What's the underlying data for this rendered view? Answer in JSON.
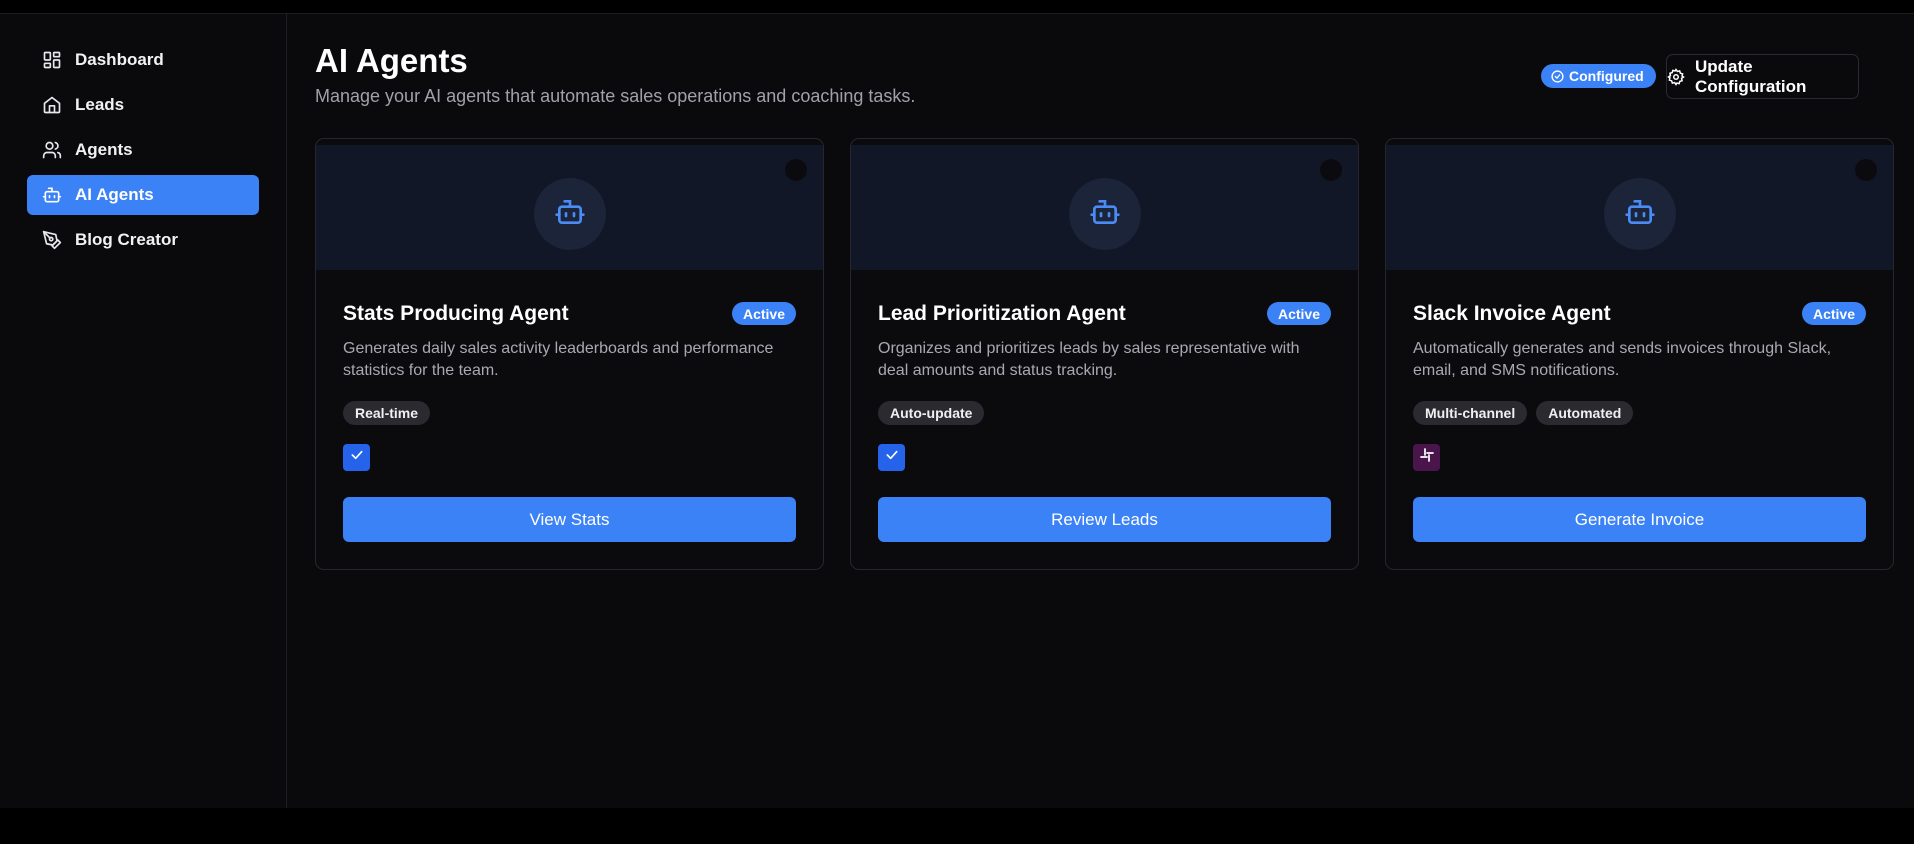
{
  "sidebar": {
    "items": [
      {
        "label": "Dashboard",
        "icon": "dashboard-icon",
        "active": false
      },
      {
        "label": "Leads",
        "icon": "home-icon",
        "active": false
      },
      {
        "label": "Agents",
        "icon": "users-icon",
        "active": false
      },
      {
        "label": "AI Agents",
        "icon": "bot-icon",
        "active": true
      },
      {
        "label": "Blog Creator",
        "icon": "pen-icon",
        "active": false
      }
    ]
  },
  "header": {
    "title": "AI Agents",
    "subtitle": "Manage your AI agents that automate sales operations and coaching tasks.",
    "configured_label": "Configured",
    "update_label": "Update Configuration"
  },
  "cards": [
    {
      "title": "Stats Producing Agent",
      "status": "Active",
      "description": "Generates daily sales activity leaderboards and performance statistics for the team.",
      "tags": [
        "Real-time"
      ],
      "indicator": "checkbox",
      "action": "View Stats"
    },
    {
      "title": "Lead Prioritization Agent",
      "status": "Active",
      "description": "Organizes and prioritizes leads by sales representative with deal amounts and status tracking.",
      "tags": [
        "Auto-update"
      ],
      "indicator": "checkbox",
      "action": "Review Leads"
    },
    {
      "title": "Slack Invoice Agent",
      "status": "Active",
      "description": "Automatically generates and sends invoices through Slack, email, and SMS notifications.",
      "tags": [
        "Multi-channel",
        "Automated"
      ],
      "indicator": "slack-icon",
      "action": "Generate Invoice"
    }
  ],
  "colors": {
    "accent": "#3b82f6",
    "background": "#0a0a0d",
    "hero": "#111726",
    "slack": "#4a154b"
  }
}
